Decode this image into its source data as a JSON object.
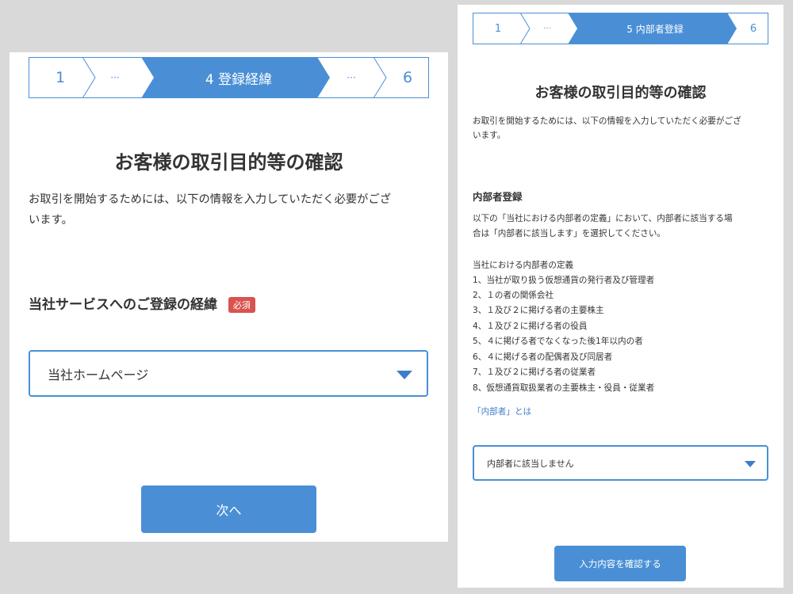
{
  "left_screen": {
    "stepper": {
      "step_first": "1",
      "step_prev_ellipsis": "···",
      "step_current": "4 登録経緯",
      "step_next_ellipsis": "···",
      "step_last": "6"
    },
    "title": "お客様の取引目的等の確認",
    "description_line1": "お取引を開始するためには、以下の情報を入力していただく必要がござ",
    "description_line2": "います。",
    "section_heading": "当社サービスへのご登録の経緯",
    "required_badge": "必須",
    "select_value": "当社ホームページ",
    "next_button": "次へ"
  },
  "right_screen": {
    "stepper": {
      "step_first": "1",
      "step_prev_ellipsis": "···",
      "step_current": "5 内部者登録",
      "step_last": "6"
    },
    "title": "お客様の取引目的等の確認",
    "description_line1": "お取引を開始するためには、以下の情報を入力していただく必要がござ",
    "description_line2": "います。",
    "section_heading": "内部者登録",
    "instruction_line1": "以下の「当社における内部者の定義」において、内部者に該当する場",
    "instruction_line2": "合は「内部者に該当します」を選択してください。",
    "definition_heading": "当社における内部者の定義",
    "definition_items": [
      "1、当社が取り扱う仮想通貨の発行者及び管理者",
      "2、１の者の関係会社",
      "3、１及び２に掲げる者の主要株主",
      "4、１及び２に掲げる者の役員",
      "5、４に掲げる者でなくなった後1年以内の者",
      "6、４に掲げる者の配偶者及び同居者",
      "7、１及び２に掲げる者の従業者",
      "8、仮想通貨取扱業者の主要株主・役員・従業者"
    ],
    "insider_link": "「内部者」とは",
    "select_value": "内部者に該当しません",
    "confirm_button": "入力内容を確認する"
  },
  "colors": {
    "accent": "#4a8fd6",
    "accent_dark": "#3d7dca",
    "badge_red": "#d9534f",
    "background": "#d9d9d9"
  },
  "icons": {
    "dropdown_caret": "chevron-down-icon"
  }
}
